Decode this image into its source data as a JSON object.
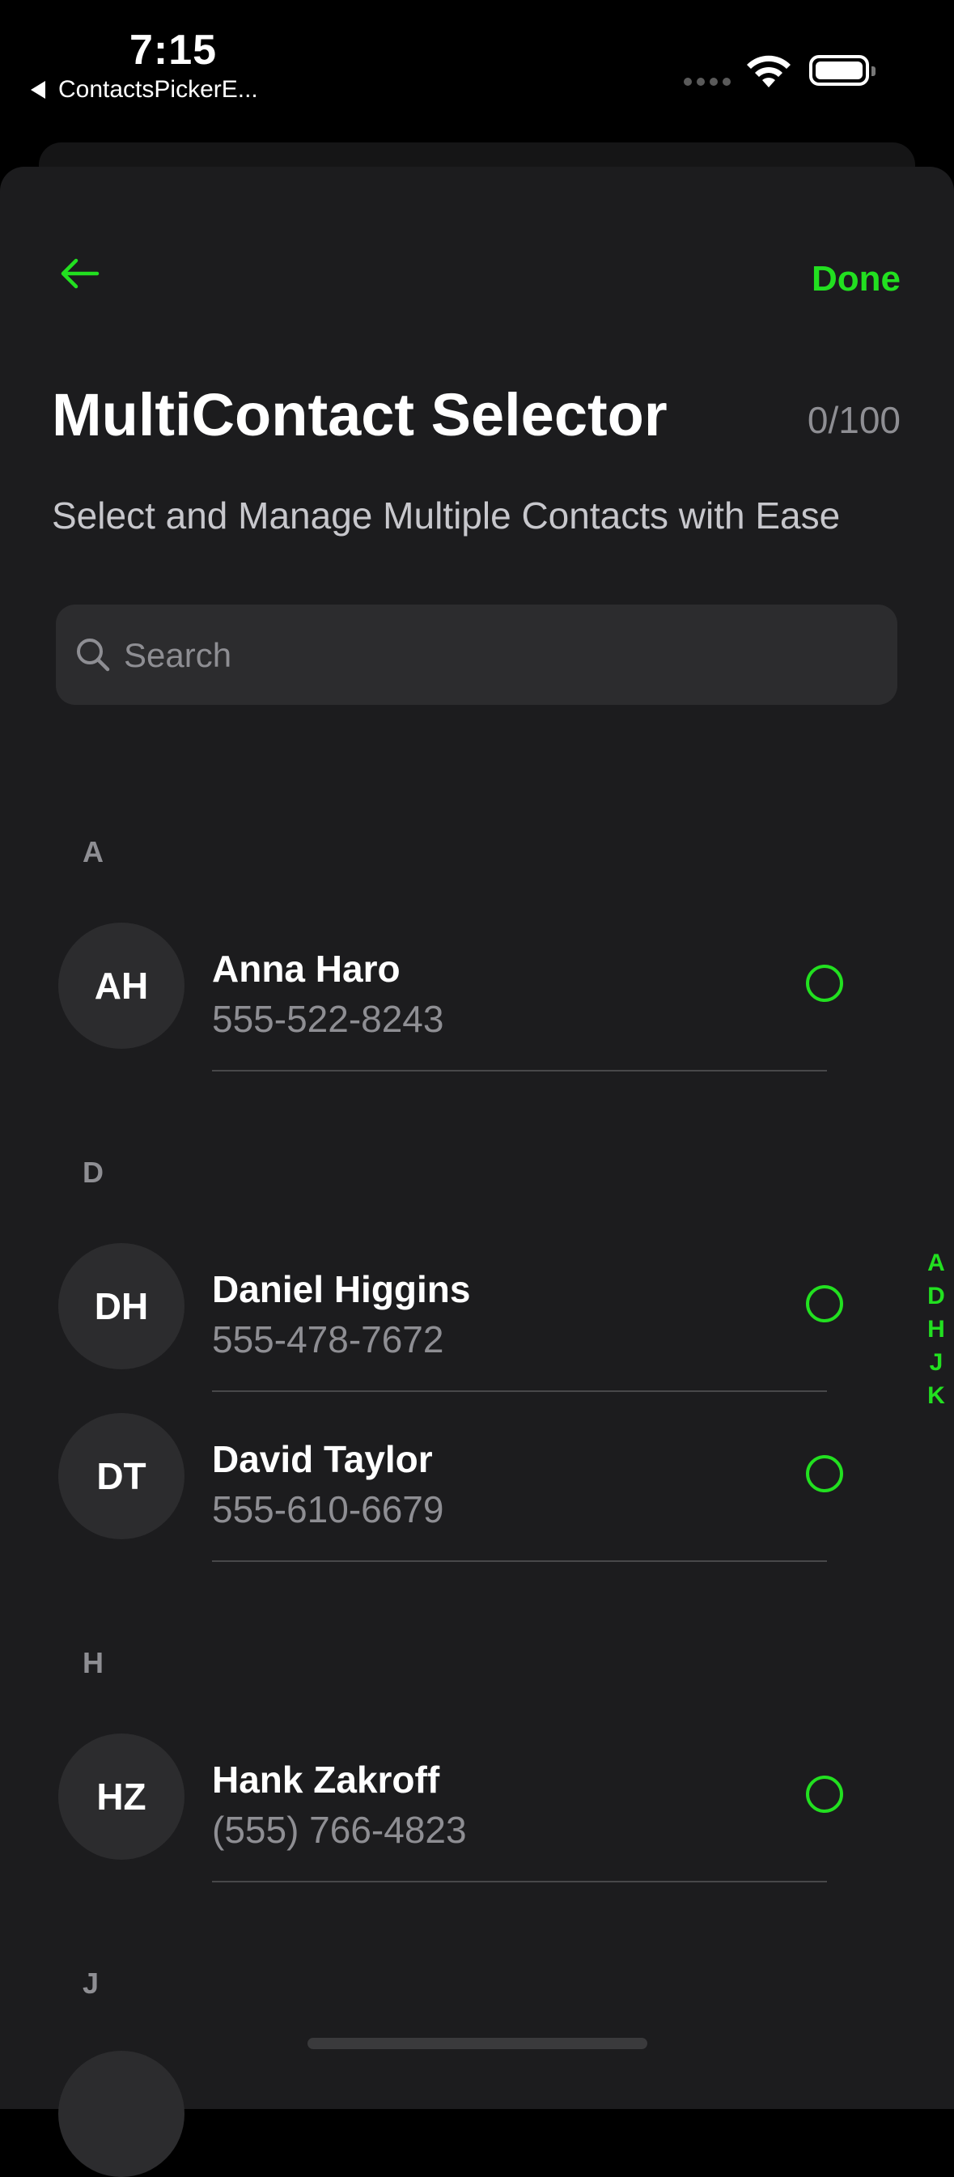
{
  "status_bar": {
    "time": "7:15",
    "back_app_label": "ContactsPickerE..."
  },
  "nav": {
    "done_label": "Done"
  },
  "header": {
    "title": "MultiContact Selector",
    "counter": "0/100",
    "subtitle": "Select and Manage Multiple Contacts with Ease"
  },
  "search": {
    "placeholder": "Search",
    "value": ""
  },
  "sections": [
    {
      "letter": "A",
      "contacts": [
        {
          "initials": "AH",
          "name": "Anna Haro",
          "phone": "555-522-8243"
        }
      ]
    },
    {
      "letter": "D",
      "contacts": [
        {
          "initials": "DH",
          "name": "Daniel Higgins",
          "phone": "555-478-7672"
        },
        {
          "initials": "DT",
          "name": "David Taylor",
          "phone": "555-610-6679"
        }
      ]
    },
    {
      "letter": "H",
      "contacts": [
        {
          "initials": "HZ",
          "name": "Hank Zakroff",
          "phone": "(555) 766-4823"
        }
      ]
    },
    {
      "letter": "J",
      "contacts": []
    }
  ],
  "index_letters": [
    "A",
    "D",
    "H",
    "J",
    "K"
  ],
  "colors": {
    "accent": "#22e020",
    "background": "#1c1c1e",
    "secondary_text": "#8e8e93"
  }
}
